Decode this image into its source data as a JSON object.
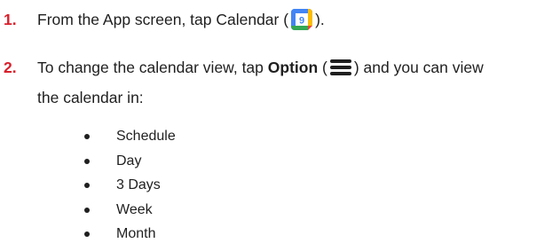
{
  "steps": [
    {
      "number": "1.",
      "text_before": "From the App screen, tap Calendar (",
      "icon": "google-calendar-icon",
      "text_after": ")."
    },
    {
      "number": "2.",
      "text_before": "To change the calendar view, tap ",
      "bold_label": "Option",
      "paren_open": "(",
      "icon": "hamburger-menu-icon",
      "text_after": ") and you can view",
      "continuation": "the calendar in:"
    }
  ],
  "calendar_icon_digit": "9",
  "views": [
    "Schedule",
    "Day",
    "3 Days",
    "Week",
    "Month"
  ],
  "colors": {
    "step_number": "#d9202c",
    "text": "#1f1f1f",
    "calendar_blue": "#4285f4",
    "calendar_green": "#34a853",
    "calendar_yellow": "#fbbc04",
    "calendar_red": "#ea4335"
  }
}
